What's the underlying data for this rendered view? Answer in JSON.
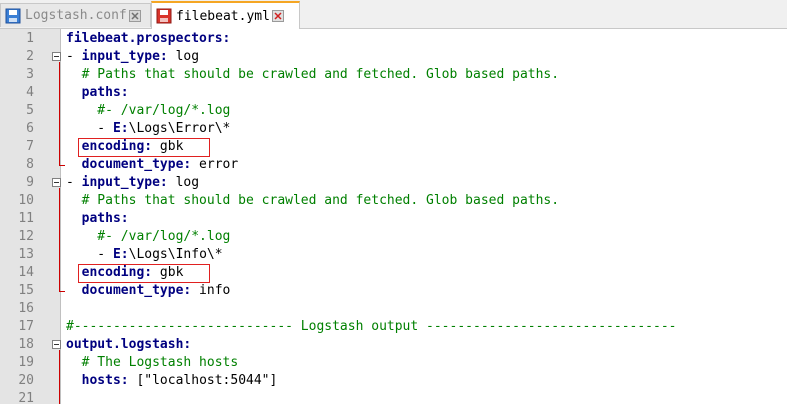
{
  "tabs": [
    {
      "label": "Logstash.conf",
      "active": false
    },
    {
      "label": "filebeat.yml",
      "active": true
    }
  ],
  "lines": [
    {
      "n": "1",
      "parts": [
        {
          "t": "filebeat.prospectors:",
          "c": "k"
        }
      ]
    },
    {
      "n": "2",
      "parts": [
        {
          "t": "- ",
          "c": "v"
        },
        {
          "t": "input_type:",
          "c": "k"
        },
        {
          "t": " log",
          "c": "v"
        }
      ]
    },
    {
      "n": "3",
      "parts": [
        {
          "t": "  # Paths that should be crawled and fetched. Glob based paths.",
          "c": "c"
        }
      ]
    },
    {
      "n": "4",
      "parts": [
        {
          "t": "  ",
          "c": "v"
        },
        {
          "t": "paths:",
          "c": "k"
        }
      ]
    },
    {
      "n": "5",
      "parts": [
        {
          "t": "    #- /var/log/*.log",
          "c": "c"
        }
      ]
    },
    {
      "n": "6",
      "parts": [
        {
          "t": "    - ",
          "c": "v"
        },
        {
          "t": "E:",
          "c": "k"
        },
        {
          "t": "\\Logs\\Error\\*",
          "c": "v"
        }
      ]
    },
    {
      "n": "7",
      "parts": [
        {
          "t": "  ",
          "c": "v"
        },
        {
          "t": "encoding:",
          "c": "k"
        },
        {
          "t": " gbk",
          "c": "v"
        }
      ]
    },
    {
      "n": "8",
      "parts": [
        {
          "t": "  ",
          "c": "v"
        },
        {
          "t": "document_type:",
          "c": "k"
        },
        {
          "t": " error",
          "c": "v"
        }
      ]
    },
    {
      "n": "9",
      "parts": [
        {
          "t": "- ",
          "c": "v"
        },
        {
          "t": "input_type:",
          "c": "k"
        },
        {
          "t": " log",
          "c": "v"
        }
      ]
    },
    {
      "n": "10",
      "parts": [
        {
          "t": "  # Paths that should be crawled and fetched. Glob based paths.",
          "c": "c"
        }
      ]
    },
    {
      "n": "11",
      "parts": [
        {
          "t": "  ",
          "c": "v"
        },
        {
          "t": "paths:",
          "c": "k"
        }
      ]
    },
    {
      "n": "12",
      "parts": [
        {
          "t": "    #- /var/log/*.log",
          "c": "c"
        }
      ]
    },
    {
      "n": "13",
      "parts": [
        {
          "t": "    - ",
          "c": "v"
        },
        {
          "t": "E:",
          "c": "k"
        },
        {
          "t": "\\Logs\\Info\\*",
          "c": "v"
        }
      ]
    },
    {
      "n": "14",
      "parts": [
        {
          "t": "  ",
          "c": "v"
        },
        {
          "t": "encoding:",
          "c": "k"
        },
        {
          "t": " gbk",
          "c": "v"
        }
      ]
    },
    {
      "n": "15",
      "parts": [
        {
          "t": "  ",
          "c": "v"
        },
        {
          "t": "document_type:",
          "c": "k"
        },
        {
          "t": " info",
          "c": "v"
        }
      ]
    },
    {
      "n": "16",
      "parts": []
    },
    {
      "n": "17",
      "parts": [
        {
          "t": "#---------------------------- Logstash output --------------------------------",
          "c": "c"
        }
      ]
    },
    {
      "n": "18",
      "parts": [
        {
          "t": "output.logstash:",
          "c": "k"
        }
      ]
    },
    {
      "n": "19",
      "parts": [
        {
          "t": "  # The Logstash hosts",
          "c": "c"
        }
      ]
    },
    {
      "n": "20",
      "parts": [
        {
          "t": "  ",
          "c": "v"
        },
        {
          "t": "hosts:",
          "c": "k"
        },
        {
          "t": " [\"localhost:5044\"]",
          "c": "v"
        }
      ]
    },
    {
      "n": "21",
      "parts": []
    }
  ],
  "fold_lines": [
    2,
    9,
    18
  ],
  "highlighted_lines": [
    7,
    14
  ],
  "colors": {
    "keyword": "#000080",
    "comment": "#008000",
    "highlight_box": "#e02020",
    "fold_marker": "#cc0000"
  }
}
